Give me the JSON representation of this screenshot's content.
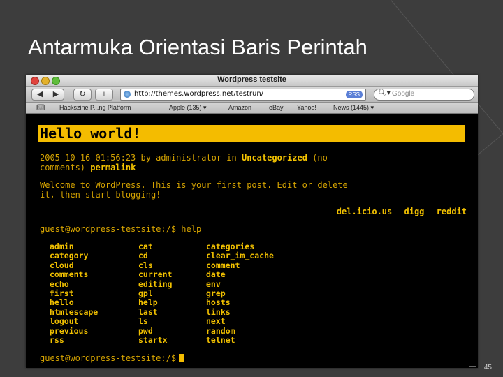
{
  "slide": {
    "title": "Antarmuka Orientasi Baris Perintah",
    "page_number": "45"
  },
  "browser": {
    "window_title": "Wordpress testsite",
    "back_label": "◀",
    "forward_label": "▶",
    "reload_label": "↻",
    "add_label": "+",
    "url": "http://themes.wordpress.net/testrun/",
    "rss_label": "RSS",
    "search_placeholder": "Google",
    "bookmarks": [
      "Hackszine P...ng Platform",
      "Apple (135) ▾",
      "Amazon",
      "eBay",
      "Yahoo!",
      "News (1445) ▾"
    ]
  },
  "post": {
    "title": "Hello world!",
    "meta_date": "2005-10-16 01:56:23 by administrator in",
    "meta_category": "Uncategorized",
    "meta_comments": "(no",
    "meta_line2_a": "comments)",
    "meta_permalink": "permalink",
    "welcome_line1": "Welcome to WordPress. This is your first post. Edit or delete",
    "welcome_line2": "it, then start blogging!",
    "social": [
      "del.icio.us",
      "digg",
      "reddit"
    ]
  },
  "terminal": {
    "prompt_help": "guest@wordpress-testsite:/$ help",
    "prompt_final": "guest@wordpress-testsite:/$",
    "commands_col1": [
      "admin",
      "category",
      "cloud",
      "comments",
      "echo",
      "first",
      "hello",
      "htmlescape",
      "logout",
      "previous",
      "rss"
    ],
    "commands_col2": [
      "cat",
      "cd",
      "cls",
      "current",
      "editing",
      "gpl",
      "help",
      "last",
      "ls",
      "pwd",
      "startx"
    ],
    "commands_col3": [
      "categories",
      "clear_im_cache",
      "comment",
      "date",
      "env",
      "grep",
      "hosts",
      "links",
      "next",
      "random",
      "telnet"
    ]
  },
  "colors": {
    "slide_bg": "#3d3d3d",
    "terminal_bg": "#000000",
    "accent_yellow": "#f4bc00",
    "text_gold": "#d6a400"
  }
}
